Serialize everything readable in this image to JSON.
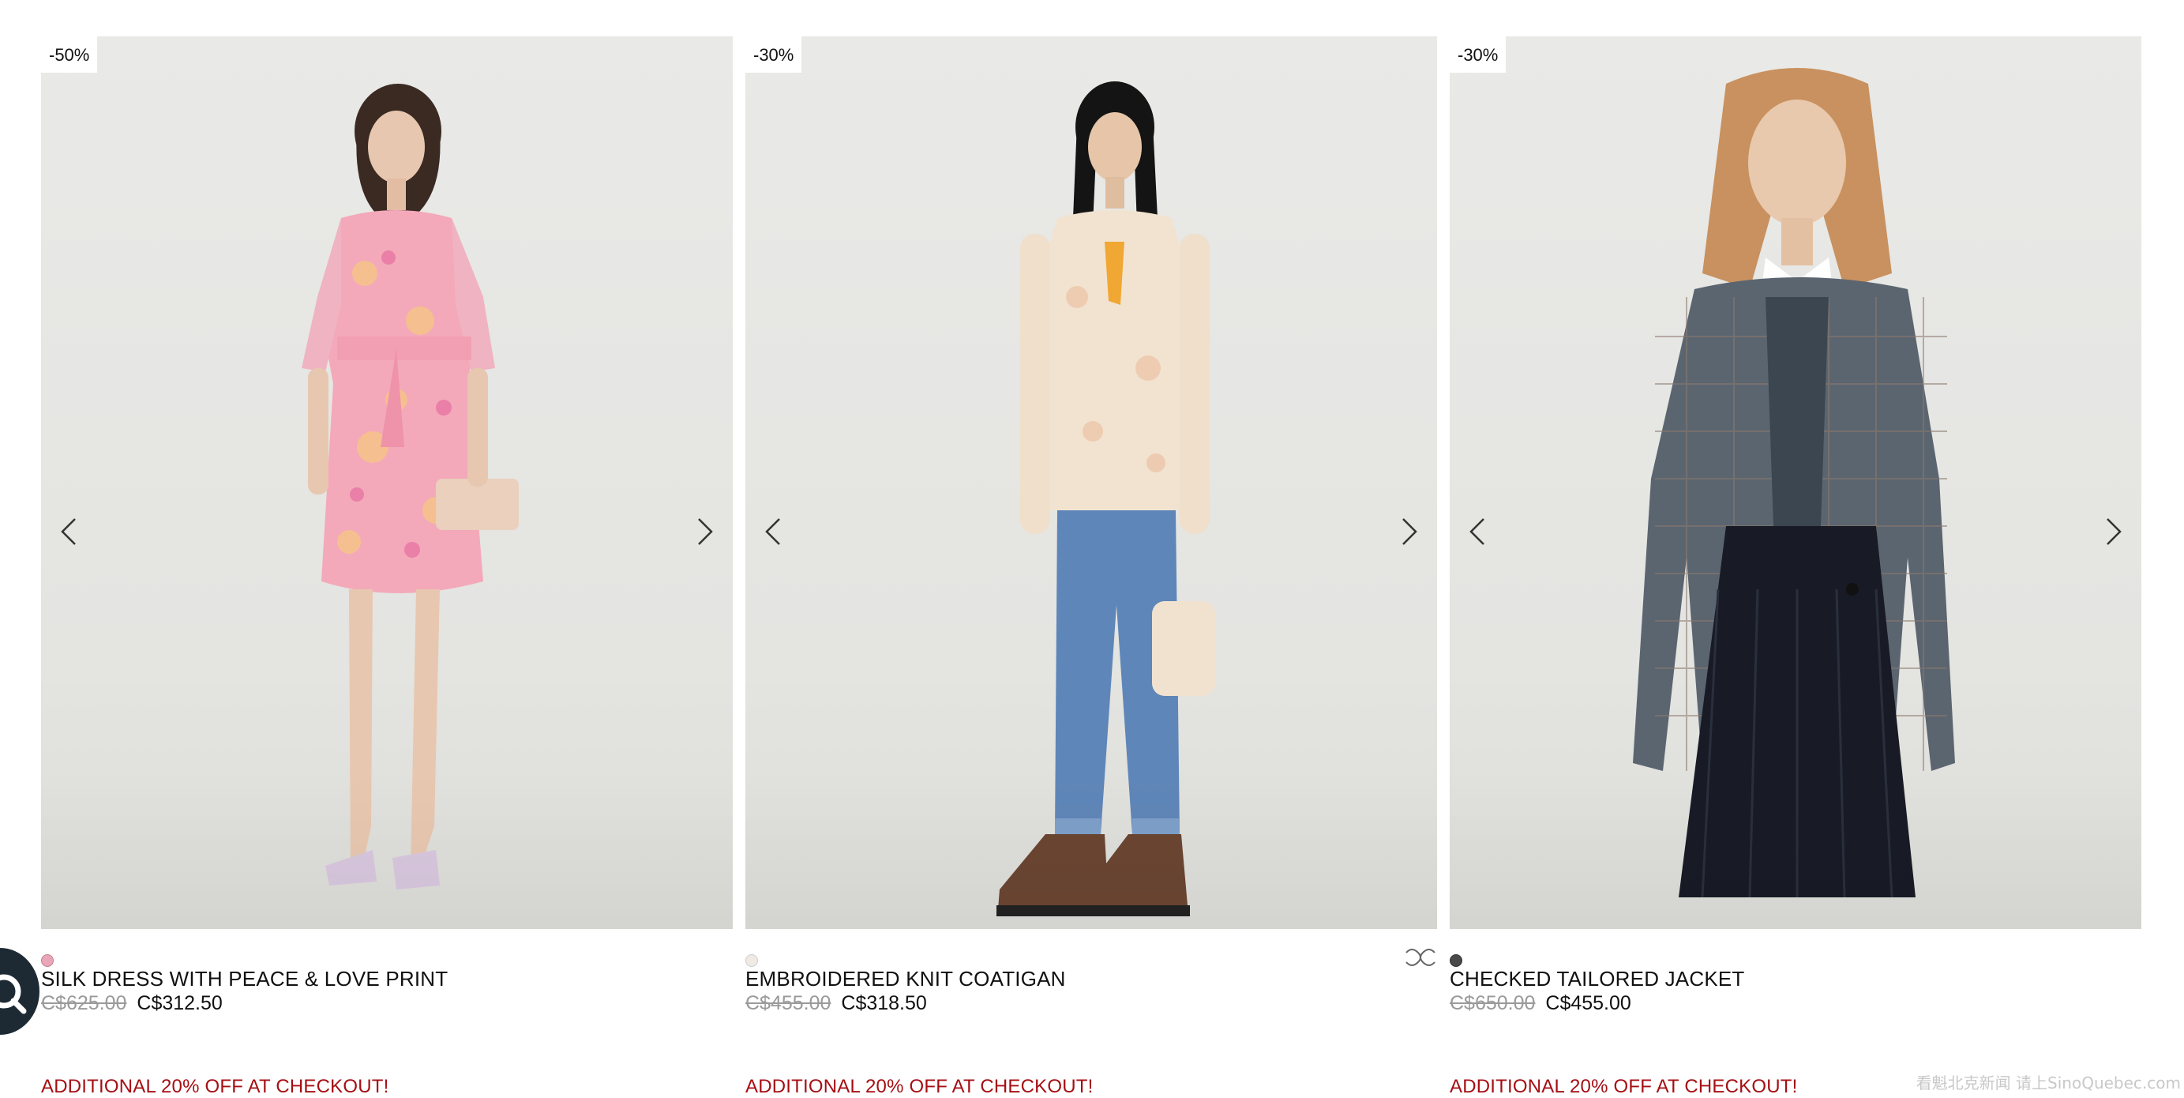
{
  "products": [
    {
      "badge": "-50%",
      "name": "SILK DRESS WITH PEACE & LOVE PRINT",
      "old_price": "C$625.00",
      "new_price": "C$312.50",
      "promo": "ADDITIONAL 20% OFF AT CHECKOUT!",
      "swatch_color": "#e9a6b8",
      "image_desc": "model in pink floral mini dress"
    },
    {
      "badge": "-30%",
      "name": "EMBROIDERED KNIT COATIGAN",
      "old_price": "C$455.00",
      "new_price": "C$318.50",
      "promo": "ADDITIONAL 20% OFF AT CHECKOUT!",
      "swatch_color": "#efeae3",
      "image_desc": "model in cream knit coatigan and jeans"
    },
    {
      "badge": "-30%",
      "name": "CHECKED TAILORED JACKET",
      "old_price": "C$650.00",
      "new_price": "C$455.00",
      "promo": "ADDITIONAL 20% OFF AT CHECKOUT!",
      "swatch_color": "#4a4a4a",
      "image_desc": "model in checked blazer and pleated skirt"
    }
  ],
  "icons": {
    "prev": "chevron-left-icon",
    "next": "chevron-right-icon",
    "brand": "sandro-logo-icon",
    "chat": "chat-search-icon"
  },
  "colors": {
    "promo": "#a50f14",
    "old_price": "#9a9a9a",
    "chat_button": "#1d2a34"
  },
  "watermark": "看魁北克新闻 请上SinoQuebec.com"
}
